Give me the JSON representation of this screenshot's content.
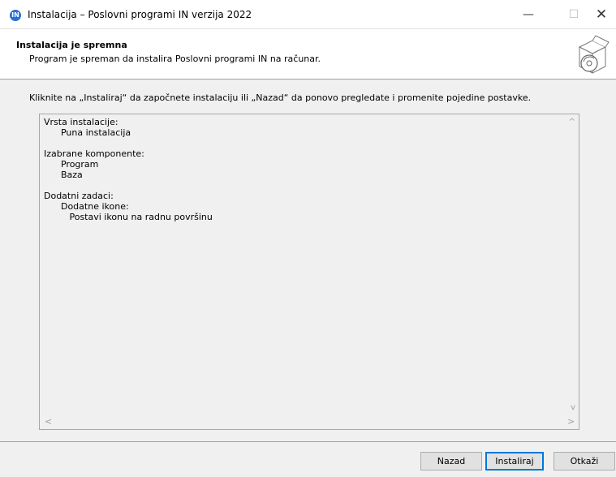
{
  "window": {
    "title": "Instalacija – Poslovni programi IN verzija 2022",
    "app_icon_glyph": "IN",
    "minimize_glyph": "—",
    "maximize_glyph": "☐",
    "close_glyph": "✕"
  },
  "header": {
    "title": "Instalacija je spremna",
    "subtitle": "Program je spreman da instalira Poslovni programi IN na računar.",
    "icon": "box-with-disc-icon"
  },
  "instruction": "Kliknite na „Instaliraj“ da započnete instalaciju ili „Nazad“ da ponovo pregledate i promenite pojedine postavke.",
  "memo": {
    "lines": [
      "Vrsta instalacije:",
      "      Puna instalacija",
      "",
      "Izabrane komponente:",
      "      Program",
      "      Baza",
      "",
      "Dodatni zadaci:",
      "      Dodatne ikone:",
      "         Postavi ikonu na radnu površinu"
    ],
    "scroll_up_glyph": "^",
    "scroll_down_glyph": "v",
    "scroll_left_glyph": "<",
    "scroll_right_glyph": ">"
  },
  "buttons": {
    "back": "Nazad",
    "install": "Instaliraj",
    "cancel": "Otkaži"
  },
  "colors": {
    "accent": "#0078d7",
    "app_icon": "#2a6fd6"
  }
}
